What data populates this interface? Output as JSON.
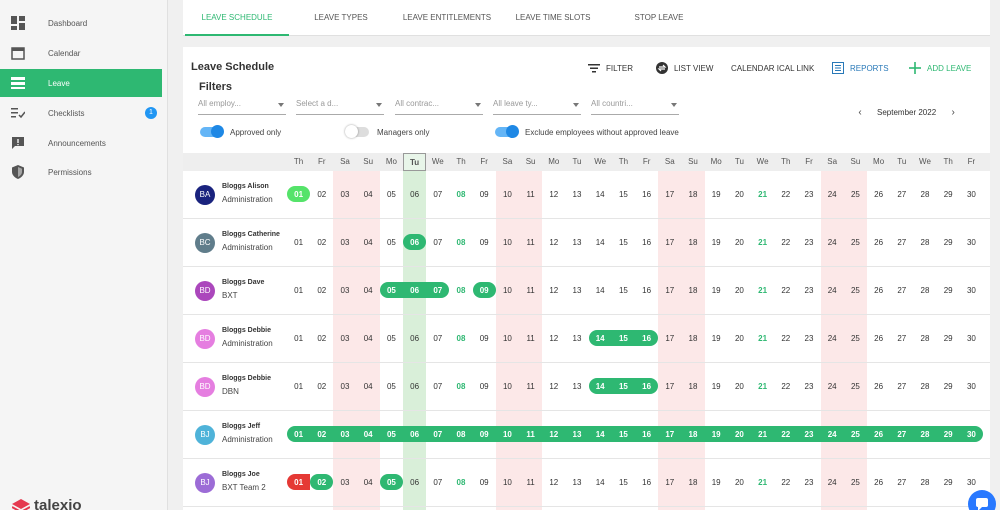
{
  "sidebar": {
    "items": [
      {
        "label": "Dashboard",
        "icon": "dashboard-icon"
      },
      {
        "label": "Calendar",
        "icon": "calendar-icon"
      },
      {
        "label": "Leave",
        "icon": "leave-icon",
        "active": true
      },
      {
        "label": "Checklists",
        "icon": "checklist-icon",
        "badge": "1"
      },
      {
        "label": "Announcements",
        "icon": "announcement-icon"
      },
      {
        "label": "Permissions",
        "icon": "shield-icon"
      }
    ],
    "logo_text": "talexio"
  },
  "tabs": [
    "LEAVE SCHEDULE",
    "LEAVE TYPES",
    "LEAVE ENTITLEMENTS",
    "LEAVE TIME SLOTS",
    "STOP LEAVE"
  ],
  "panel": {
    "title": "Leave Schedule",
    "filters_title": "Filters",
    "toolbar": {
      "filter": "FILTER",
      "list_view": "LIST VIEW",
      "ical": "CALENDAR ICAL LINK",
      "reports": "REPORTS",
      "add_leave": "ADD LEAVE"
    },
    "selects": [
      "All employ...",
      "Select a d...",
      "All contrac...",
      "All leave ty...",
      "All countri..."
    ],
    "month_label": "September 2022",
    "toggles": [
      {
        "label": "Approved only",
        "on": true
      },
      {
        "label": "Managers only",
        "on": false
      },
      {
        "label": "Exclude employees without approved leave",
        "on": true
      }
    ]
  },
  "calendar": {
    "weekdays": [
      "Th",
      "Fr",
      "Sa",
      "Su",
      "Mo",
      "Tu",
      "We",
      "Th",
      "Fr",
      "Sa",
      "Su",
      "Mo",
      "Tu",
      "We",
      "Th",
      "Fr",
      "Sa",
      "Su",
      "Mo",
      "Tu",
      "We",
      "Th",
      "Fr",
      "Sa",
      "Su",
      "Mo",
      "Tu",
      "We",
      "Th",
      "Fr"
    ],
    "days": [
      "01",
      "02",
      "03",
      "04",
      "05",
      "06",
      "07",
      "08",
      "09",
      "10",
      "11",
      "12",
      "13",
      "14",
      "15",
      "16",
      "17",
      "18",
      "19",
      "20",
      "21",
      "22",
      "23",
      "24",
      "25",
      "26",
      "27",
      "28",
      "29",
      "30"
    ],
    "today_index": 5,
    "weekend_indices": [
      2,
      3,
      9,
      10,
      16,
      17,
      23,
      24
    ],
    "holiday_indices": [
      7,
      20
    ],
    "colors": {
      "leave": "#2eb872",
      "leave_bright": "#55e36a",
      "leave_red": "#e53935",
      "weekend": "#fce8e8",
      "today": "#d9efd9"
    },
    "employees": [
      {
        "initials": "BA",
        "name": "Bloggs Alison",
        "dept": "Administration",
        "avatar_color": "#1a237e",
        "leave": [
          {
            "start": 0,
            "end": 0,
            "style": "lime"
          }
        ]
      },
      {
        "initials": "BC",
        "name": "Bloggs Catherine",
        "dept": "Administration",
        "avatar_color": "#607d8b",
        "leave": [
          {
            "start": 5,
            "end": 5,
            "style": "green"
          }
        ]
      },
      {
        "initials": "BD",
        "name": "Bloggs Dave",
        "dept": "BXT",
        "avatar_color": "#ab47bc",
        "leave": [
          {
            "start": 4,
            "end": 6,
            "style": "green"
          },
          {
            "start": 8,
            "end": 8,
            "style": "green"
          }
        ]
      },
      {
        "initials": "BD",
        "name": "Bloggs Debbie",
        "dept": "Administration",
        "avatar_color": "#e57ee0",
        "leave": [
          {
            "start": 13,
            "end": 15,
            "style": "green"
          }
        ]
      },
      {
        "initials": "BD",
        "name": "Bloggs Debbie",
        "dept": "DBN",
        "avatar_color": "#e57ee0",
        "leave": [
          {
            "start": 13,
            "end": 15,
            "style": "green"
          }
        ]
      },
      {
        "initials": "BJ",
        "name": "Bloggs Jeff",
        "dept": "Administration",
        "avatar_color": "#4fb3d9",
        "leave": [
          {
            "start": 0,
            "end": 29,
            "style": "green"
          }
        ]
      },
      {
        "initials": "BJ",
        "name": "Bloggs Joe",
        "dept": "BXT Team 2",
        "avatar_color": "#9c6cd6",
        "leave": [
          {
            "start": 0,
            "end": 0,
            "style": "red"
          },
          {
            "start": 1,
            "end": 1,
            "style": "green"
          },
          {
            "start": 4,
            "end": 4,
            "style": "green"
          }
        ]
      }
    ]
  }
}
